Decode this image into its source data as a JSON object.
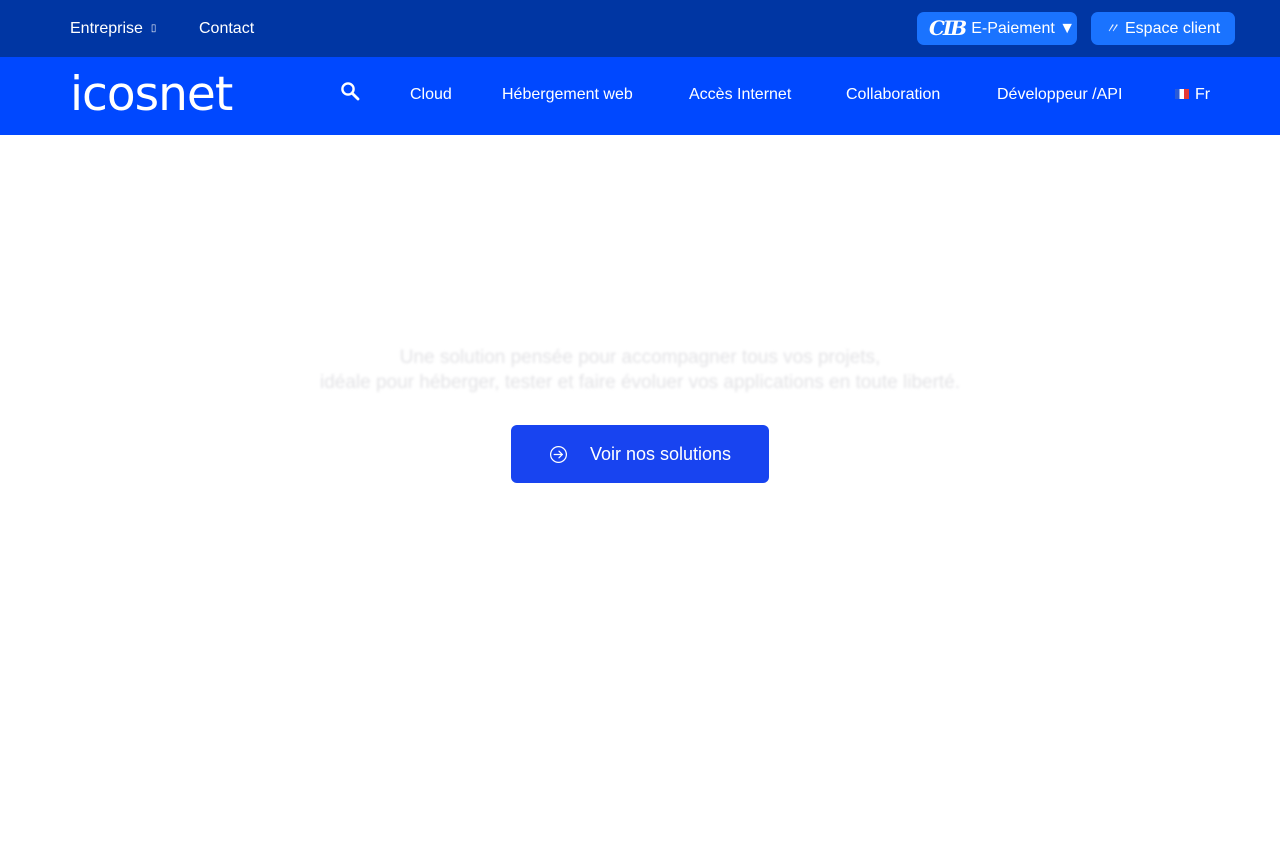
{
  "topbar": {
    "entreprise_label": "Entreprise",
    "entreprise_caret": "▯",
    "contact_label": "Contact",
    "payment": {
      "logo_text": "CIB",
      "label": "E-Paiement ▼"
    },
    "client_space": {
      "icon_glyph": "〃",
      "label": "Espace client"
    }
  },
  "nav": {
    "logo_text": "icosnet",
    "items": [
      {
        "label": "Cloud"
      },
      {
        "label": "Hébergement web"
      },
      {
        "label": "Accès Internet"
      },
      {
        "label": "Collaboration"
      },
      {
        "label": "Développeur /API"
      }
    ],
    "language_label": "Fr"
  },
  "hero": {
    "line1": "Une solution pensée pour accompagner tous vos projets,",
    "line2": "idéale pour héberger, tester et faire évoluer vos applications en toute liberté.",
    "cta_label": "Voir nos solutions"
  },
  "colors": {
    "topbar_bg": "#0036a3",
    "nav_bg": "#0048ff",
    "pill_bg": "#1a73ff",
    "cta_bg": "#1844f0"
  },
  "icons": {
    "search": "search-icon",
    "cta": "arrow-circle-right-icon",
    "language_flag": "flag-fr-icon"
  }
}
